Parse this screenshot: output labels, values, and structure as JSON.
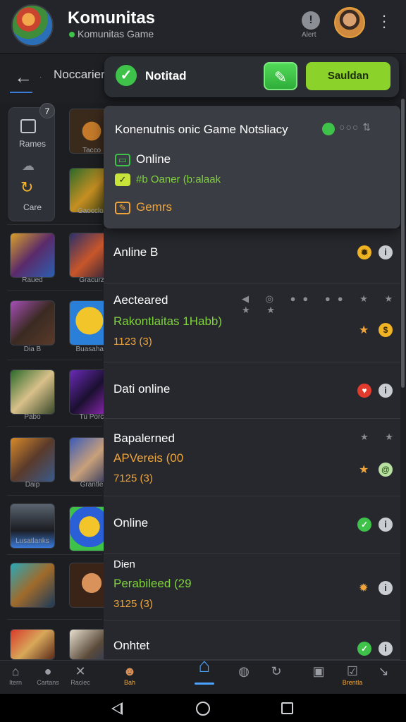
{
  "header": {
    "title": "Komunitas",
    "subtitle": "Komunitas Game",
    "notif_label": "Alert",
    "avatar_icon": "user-avatar",
    "more_icon": "more-vertical-icon"
  },
  "subbar": {
    "back_icon": "arrow-left-icon",
    "separator": "·",
    "crumb": "Noccarier"
  },
  "status_bar": {
    "text": "Notitad",
    "primary_icon": "check-edit-icon",
    "secondary_label": "Sauldan"
  },
  "side_panel": {
    "badge": "7",
    "label_top": "Rames",
    "label_bottom": "Care"
  },
  "games": [
    {
      "label": "Tacco",
      "col": 2
    },
    {
      "label": "Gaocclor",
      "col": 2
    },
    {
      "label": "Raued",
      "col": 1
    },
    {
      "label": "Gracurz",
      "col": 2
    },
    {
      "label": "Dia B",
      "col": 1
    },
    {
      "label": "Buasahan",
      "col": 2
    },
    {
      "label": "Pabo",
      "col": 1
    },
    {
      "label": "Tu Porc",
      "col": 2
    },
    {
      "label": "Daip",
      "col": 1
    },
    {
      "label": "Grantle",
      "col": 2
    },
    {
      "label": "Lusatlanks",
      "col": 1
    },
    {
      "label": "",
      "col": 2
    },
    {
      "label": "",
      "col": 1
    },
    {
      "label": "",
      "col": 2
    }
  ],
  "dropdown": {
    "title": "Konenutnis onic Game Notsliacy",
    "dots": "○○○ ⇅",
    "rows": [
      {
        "label": "Online",
        "icon": "chat-icon"
      },
      {
        "label": "#b Oaner (b:alaak",
        "icon": "check-icon"
      },
      {
        "label": "Gemrs",
        "icon": "edit-icon"
      }
    ]
  },
  "list": [
    {
      "title": "Anline B",
      "status_color": "#f0b323"
    },
    {
      "title": "Aecteared",
      "sub": "Rakontlaitas 1Habb)",
      "meta": "1123 (3)",
      "stars": "◀ ◎ ●● ●● ★ ★ ★ ★"
    },
    {
      "title": "Dati online",
      "status_color": "#e23b2e"
    },
    {
      "title": "Bapalerned",
      "sub": "APVereis (00",
      "meta": "7125 (3)",
      "stars": "★ ★"
    },
    {
      "title": "Online",
      "status_color": "#3fc24a"
    },
    {
      "title": "Dien",
      "sub": "Perabileed (29",
      "meta": "3125 (3)"
    },
    {
      "title": "Onhtet",
      "status_color": "#3fc24a"
    }
  ],
  "bottom_nav": [
    {
      "label": "Itern",
      "icon": "home-outline-icon"
    },
    {
      "label": "Cartans",
      "icon": "person-icon"
    },
    {
      "label": "Raciec",
      "icon": "cross-icon"
    },
    {
      "label": "Bah",
      "icon": "avatar-icon"
    },
    {
      "label": "",
      "icon": "home-icon"
    },
    {
      "label": "",
      "icon": "compass-icon"
    },
    {
      "label": "",
      "icon": "refresh-icon"
    },
    {
      "label": "",
      "icon": "image-icon"
    },
    {
      "label": "Brentla",
      "icon": "check-box-icon"
    },
    {
      "label": "",
      "icon": "share-icon"
    }
  ],
  "colors": {
    "accent": "#3fc24a",
    "lime": "#8bd32a",
    "orange": "#f0a53a",
    "blue": "#49a3ff",
    "bg": "#1c1e22"
  }
}
